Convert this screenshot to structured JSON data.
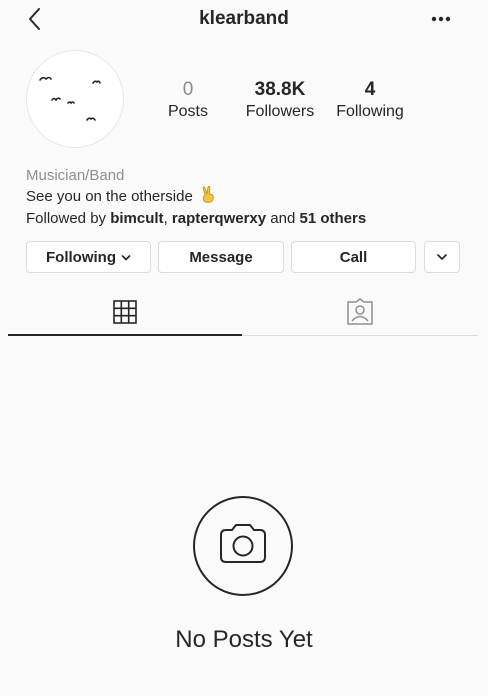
{
  "header": {
    "username": "klearband",
    "back_icon": "chevron-left-icon",
    "more_icon": "more-horizontal-icon"
  },
  "profile": {
    "stats": [
      {
        "value": "0",
        "label": "Posts"
      },
      {
        "value": "38.8K",
        "label": "Followers"
      },
      {
        "value": "4",
        "label": "Following"
      }
    ],
    "category": "Musician/Band",
    "bio": "See you on the otherside",
    "bio_emoji": "victory-hand-emoji",
    "followed_by_prefix": "Followed by ",
    "followed_by_user1": "bimcult",
    "followed_by_sep": ", ",
    "followed_by_user2": "rapterqwerxy",
    "followed_by_and": " and ",
    "followed_by_others": "51 others"
  },
  "actions": {
    "following_label": "Following",
    "message_label": "Message",
    "call_label": "Call",
    "more_icon": "chevron-down-icon"
  },
  "tabs": [
    {
      "name": "grid",
      "icon": "grid-icon",
      "active": true
    },
    {
      "name": "tagged",
      "icon": "tagged-person-icon",
      "active": false
    }
  ],
  "empty_state": {
    "icon": "camera-icon",
    "text": "No Posts Yet"
  },
  "colors": {
    "text": "#262626",
    "muted": "#8e8e8e",
    "border": "#dbdbdb",
    "background": "#fafafa"
  }
}
